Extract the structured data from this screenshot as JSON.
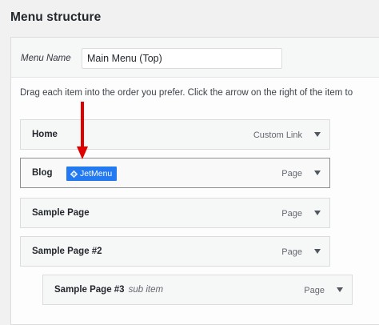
{
  "section_title": "Menu structure",
  "menu_name": {
    "label": "Menu Name",
    "value": "Main Menu (Top)"
  },
  "instructions": "Drag each item into the order you prefer. Click the arrow on the right of the item to",
  "items": [
    {
      "title": "Home",
      "type": "Custom Link"
    },
    {
      "title": "Blog",
      "type": "Page",
      "badge": "JetMenu"
    },
    {
      "title": "Sample Page",
      "type": "Page"
    },
    {
      "title": "Sample Page #2",
      "type": "Page"
    },
    {
      "title": "Sample Page #3",
      "subtitle": "sub item",
      "type": "Page"
    }
  ],
  "colors": {
    "badge": "#2279f0",
    "annotation_arrow": "#e00000"
  },
  "icons": {
    "badge_icon": "gear-icon",
    "expand_icon": "caret-down-icon",
    "annotation_icon": "red-arrow-icon"
  }
}
